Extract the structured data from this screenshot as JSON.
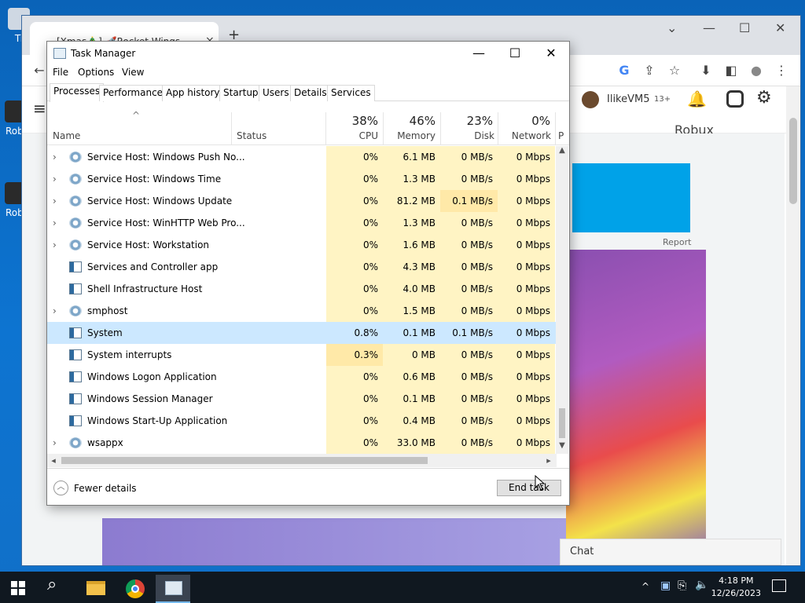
{
  "desktop": {
    "icons": [
      {
        "label": "Ti",
        "name": "desktop-icon-1"
      },
      {
        "label": "Robl",
        "name": "desktop-icon-roblox-1"
      },
      {
        "label": "Robl",
        "name": "desktop-icon-roblox-2"
      }
    ]
  },
  "browser": {
    "tab_title": "[Xmas🎄] 🚀Rocket Wings Simul…",
    "tab_close": "×",
    "new_tab": "+",
    "window_controls": {
      "minimize": "—",
      "maximize": "☐",
      "close": "✕"
    },
    "toolbar_icons": [
      "G",
      "⇪",
      "☆",
      "⬇",
      "◧",
      "●",
      "⋮"
    ],
    "page": {
      "username": "IlikeVM5",
      "age_badge": "13+",
      "robux_label": "Robux",
      "report_label": "Report",
      "chat_label": "Chat"
    }
  },
  "taskmanager": {
    "title": "Task Manager",
    "controls": {
      "minimize": "—",
      "maximize": "☐",
      "close": "✕"
    },
    "menu": [
      "File",
      "Options",
      "View"
    ],
    "tabs": [
      "Processes",
      "Performance",
      "App history",
      "Startup",
      "Users",
      "Details",
      "Services"
    ],
    "active_tab": "Processes",
    "columns": {
      "name": "Name",
      "status": "Status",
      "cpu": {
        "pct": "38%",
        "label": "CPU"
      },
      "memory": {
        "pct": "46%",
        "label": "Memory"
      },
      "disk": {
        "pct": "23%",
        "label": "Disk"
      },
      "network": {
        "pct": "0%",
        "label": "Network"
      },
      "more": "P"
    },
    "sort_caret": "^",
    "rows": [
      {
        "name": "Service Host: Windows Push No...",
        "expandable": true,
        "icon": "gear",
        "cpu": "0%",
        "memory": "6.1 MB",
        "disk": "0 MB/s",
        "network": "0 Mbps"
      },
      {
        "name": "Service Host: Windows Time",
        "expandable": true,
        "icon": "gear",
        "cpu": "0%",
        "memory": "1.3 MB",
        "disk": "0 MB/s",
        "network": "0 Mbps"
      },
      {
        "name": "Service Host: Windows Update",
        "expandable": true,
        "icon": "gear",
        "cpu": "0%",
        "memory": "81.2 MB",
        "disk": "0.1 MB/s",
        "network": "0 Mbps"
      },
      {
        "name": "Service Host: WinHTTP Web Pro...",
        "expandable": true,
        "icon": "gear",
        "cpu": "0%",
        "memory": "1.3 MB",
        "disk": "0 MB/s",
        "network": "0 Mbps"
      },
      {
        "name": "Service Host: Workstation",
        "expandable": true,
        "icon": "gear",
        "cpu": "0%",
        "memory": "1.6 MB",
        "disk": "0 MB/s",
        "network": "0 Mbps"
      },
      {
        "name": "Services and Controller app",
        "expandable": false,
        "icon": "app",
        "cpu": "0%",
        "memory": "4.3 MB",
        "disk": "0 MB/s",
        "network": "0 Mbps"
      },
      {
        "name": "Shell Infrastructure Host",
        "expandable": false,
        "icon": "app",
        "cpu": "0%",
        "memory": "4.0 MB",
        "disk": "0 MB/s",
        "network": "0 Mbps"
      },
      {
        "name": "smphost",
        "expandable": true,
        "icon": "gear",
        "cpu": "0%",
        "memory": "1.5 MB",
        "disk": "0 MB/s",
        "network": "0 Mbps"
      },
      {
        "name": "System",
        "expandable": false,
        "icon": "app",
        "cpu": "0.8%",
        "memory": "0.1 MB",
        "disk": "0.1 MB/s",
        "network": "0 Mbps",
        "selected": true
      },
      {
        "name": "System interrupts",
        "expandable": false,
        "icon": "app",
        "cpu": "0.3%",
        "memory": "0 MB",
        "disk": "0 MB/s",
        "network": "0 Mbps"
      },
      {
        "name": "Windows Logon Application",
        "expandable": false,
        "icon": "app",
        "cpu": "0%",
        "memory": "0.6 MB",
        "disk": "0 MB/s",
        "network": "0 Mbps"
      },
      {
        "name": "Windows Session Manager",
        "expandable": false,
        "icon": "app",
        "cpu": "0%",
        "memory": "0.1 MB",
        "disk": "0 MB/s",
        "network": "0 Mbps"
      },
      {
        "name": "Windows Start-Up Application",
        "expandable": false,
        "icon": "app",
        "cpu": "0%",
        "memory": "0.4 MB",
        "disk": "0 MB/s",
        "network": "0 Mbps"
      },
      {
        "name": "wsappx",
        "expandable": true,
        "icon": "gear",
        "cpu": "0%",
        "memory": "33.0 MB",
        "disk": "0 MB/s",
        "network": "0 Mbps"
      }
    ],
    "footer": {
      "fewer_details": "Fewer details",
      "end_task": "End task"
    }
  },
  "taskbar": {
    "time": "4:18 PM",
    "date": "12/26/2023",
    "tray_icons": [
      "^",
      "▣",
      "⎘",
      "🔈"
    ]
  },
  "colors": {
    "cpu_mild": "#fff4c4",
    "cpu_warm": "#ffe9a8",
    "selected_row": "#cce8ff",
    "taskbar_bg": "#101820",
    "desktop_bg": "#0d74d1"
  }
}
